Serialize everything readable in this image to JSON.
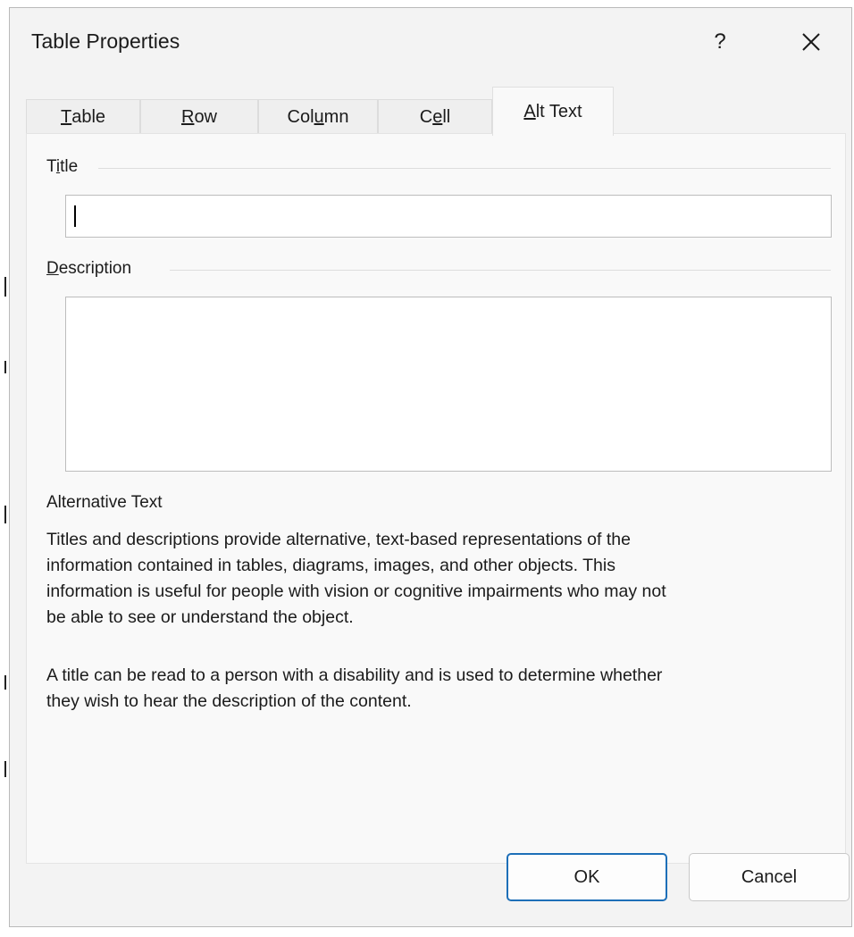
{
  "window": {
    "title": "Table Properties",
    "help_label": "?",
    "close_icon": "close-icon"
  },
  "tabs": [
    {
      "pre": "",
      "key": "T",
      "post": "able",
      "active": false
    },
    {
      "pre": "",
      "key": "R",
      "post": "ow",
      "active": false
    },
    {
      "pre": "Col",
      "key": "u",
      "post": "mn",
      "active": false
    },
    {
      "pre": "C",
      "key": "e",
      "post": "ll",
      "active": false
    },
    {
      "pre": "",
      "key": "A",
      "post": "lt Text",
      "active": true
    }
  ],
  "alt_text": {
    "title_group": {
      "pre": "T",
      "key": "i",
      "post": "tle"
    },
    "title_value": "",
    "description_group": {
      "pre": "",
      "key": "D",
      "post": "escription"
    },
    "description_value": "",
    "heading": "Alternative Text",
    "paragraph1_line1": "Titles and descriptions provide alternative, text-based representations of the",
    "paragraph1_line2": "information contained in tables, diagrams, images, and other objects. This",
    "paragraph1_line3": "information is useful for people with vision or cognitive impairments who may not",
    "paragraph1_line4": "be able to see or understand the object.",
    "paragraph2_line1": "A title can be read to a person with a disability and is used to determine whether",
    "paragraph2_line2": "they wish to hear the description of the content."
  },
  "buttons": {
    "ok": "OK",
    "cancel": "Cancel"
  },
  "colors": {
    "dialog_bg": "#f3f3f3",
    "panel_bg": "#f9f9f9",
    "ok_border": "#1d6fb8"
  }
}
